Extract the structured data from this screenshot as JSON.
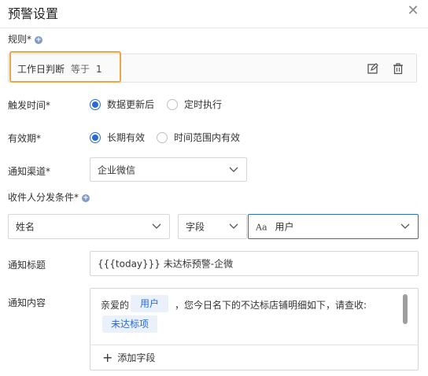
{
  "dialog": {
    "title": "预警设置",
    "close_icon": "close-icon"
  },
  "rules": {
    "label": "规则*",
    "rule": {
      "field": "工作日判断",
      "operator": "等于",
      "value": "1"
    },
    "edit_icon": "edit-icon",
    "delete_icon": "trash-icon"
  },
  "trigger": {
    "label": "触发时间*",
    "options": [
      "数据更新后",
      "定时执行"
    ],
    "selected": "数据更新后"
  },
  "validity": {
    "label": "有效期*",
    "options": [
      "长期有效",
      "时间范围内有效"
    ],
    "selected": "长期有效"
  },
  "channel": {
    "label": "通知渠道*",
    "value": "企业微信"
  },
  "recipient": {
    "label": "收件人分发条件*",
    "field_select": "姓名",
    "type_select": "字段",
    "value_prefix": "Aa",
    "value_select": "用户"
  },
  "notify_title": {
    "label": "通知标题",
    "value": "{{{today}}} 未达标预警-企微"
  },
  "notify_content": {
    "label": "通知内容",
    "greeting": "亲爱的",
    "user_tag": "用户",
    "body": "，您今日名下的不达标店铺明细如下，请查收:",
    "item_tag": "未达标项",
    "add_field_label": "添加字段"
  },
  "colors": {
    "accent": "#2a6ad8",
    "highlight": "#f0a640"
  }
}
